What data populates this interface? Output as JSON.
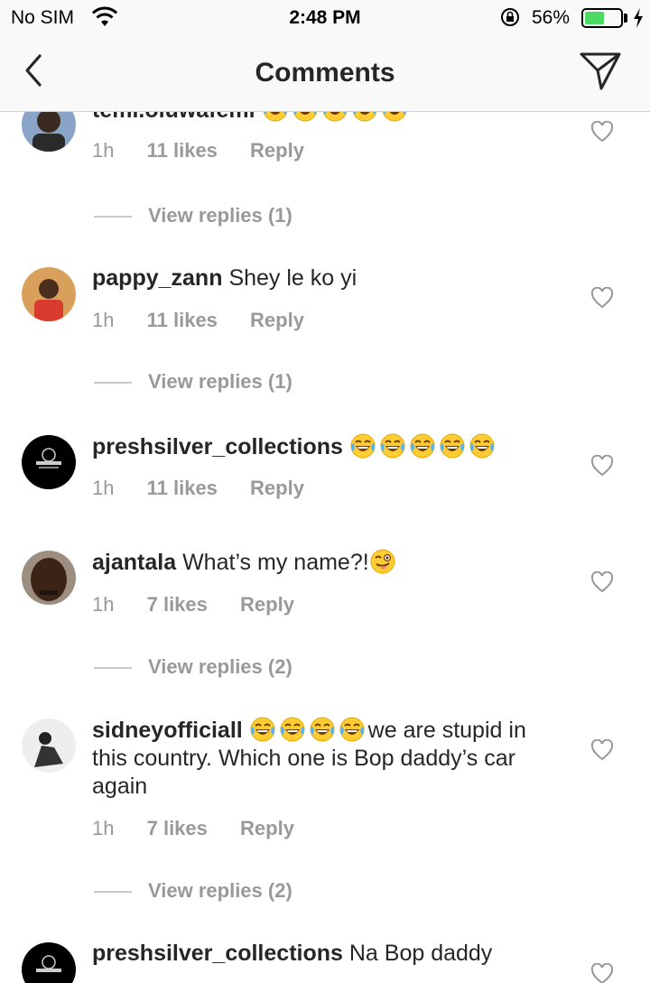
{
  "status_bar": {
    "carrier": "No SIM",
    "time": "2:48 PM",
    "battery_percent": "56%",
    "battery_level": 0.56,
    "battery_color": "#4cd964"
  },
  "nav": {
    "title": "Comments",
    "back_icon": "chevron-left-icon",
    "send_icon": "paper-plane-icon"
  },
  "comments": [
    {
      "username": "temi.oluwafemi",
      "text": "😂😂😂😂😂",
      "time": "1h",
      "likes": "11 likes",
      "reply": "Reply",
      "view_replies": "View replies (1)"
    },
    {
      "username": "pappy_zann",
      "text": "Shey le ko yi",
      "time": "1h",
      "likes": "11 likes",
      "reply": "Reply",
      "view_replies": "View replies (1)"
    },
    {
      "username": "preshsilver_collections",
      "text": "😂😂😂😂😂",
      "time": "1h",
      "likes": "11 likes",
      "reply": "Reply"
    },
    {
      "username": "ajantala",
      "text": "What’s my name?!😜",
      "time": "1h",
      "likes": "7 likes",
      "reply": "Reply",
      "view_replies": "View replies (2)"
    },
    {
      "username": "sidneyofficiall",
      "text": "😂😂😂😂we are stupid in this country. Which one is Bop daddy’s car again",
      "time": "1h",
      "likes": "7 likes",
      "reply": "Reply",
      "view_replies": "View replies (2)"
    },
    {
      "username": "preshsilver_collections",
      "text": "Na Bop daddy"
    }
  ],
  "colors": {
    "text": "#262626",
    "secondary": "#999999",
    "bar_background": "#f9f9f9"
  }
}
